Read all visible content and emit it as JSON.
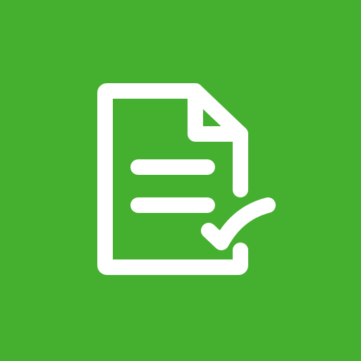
{
  "icon": {
    "name": "document-check-icon",
    "background_color": "#45B02F",
    "foreground_color": "#FFFFFF"
  }
}
